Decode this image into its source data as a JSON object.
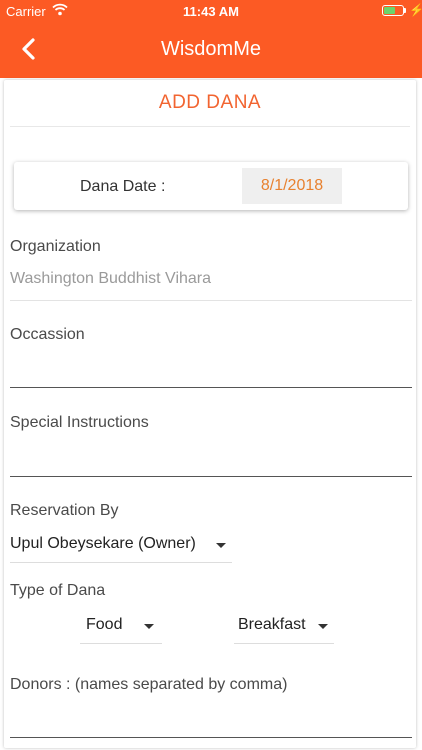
{
  "status_bar": {
    "carrier": "Carrier",
    "time": "11:43 AM",
    "battery_color": "#6bd46b"
  },
  "navbar": {
    "title": "WisdomMe",
    "back_icon": "chevron-left-icon",
    "color": "#fc5a24"
  },
  "form": {
    "title": "ADD DANA",
    "dana_date": {
      "label": "Dana Date :",
      "value": "8/1/2018"
    },
    "organization": {
      "label": "Organization",
      "value": "Washington Buddhist Vihara"
    },
    "occassion": {
      "label": "Occassion",
      "value": ""
    },
    "special_instructions": {
      "label": "Special Instructions",
      "value": ""
    },
    "reservation_by": {
      "label": "Reservation By",
      "value": "Upul Obeysekare (Owner)"
    },
    "type_of_dana": {
      "label": "Type of Dana",
      "type": "Food",
      "meal": "Breakfast"
    },
    "donors": {
      "label": "Donors : (names separated by comma)",
      "value": ""
    }
  }
}
